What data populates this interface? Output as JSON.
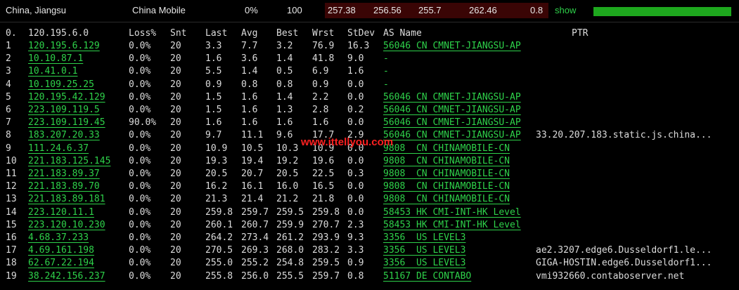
{
  "summary": {
    "location": "China, Jiangsu",
    "isp": "China Mobile",
    "loss": "0%",
    "sent": "100",
    "last": "257.38",
    "avg": "256.56",
    "best": "255.7",
    "worst": "262.46",
    "stdev": "0.8",
    "show_label": "show",
    "progress_percent": 100,
    "progress_color": "#1ea81e"
  },
  "table": {
    "headers": {
      "hop": "0.",
      "host": "120.195.6.0",
      "loss": "Loss%",
      "snt": "Snt",
      "last": "Last",
      "avg": "Avg",
      "best": "Best",
      "wrst": "Wrst",
      "stdev": "StDev",
      "asname": "AS Name",
      "ptr": "PTR"
    },
    "rows": [
      {
        "hop": "1",
        "host": "120.195.6.129",
        "loss": "0.0%",
        "snt": "20",
        "last": "3.3",
        "avg": "7.7",
        "best": "3.2",
        "wrst": "76.9",
        "stdev": "16.3",
        "as": "56046 CN CMNET-JIANGSU-AP",
        "ptr": ""
      },
      {
        "hop": "2",
        "host": "10.10.87.1",
        "loss": "0.0%",
        "snt": "20",
        "last": "1.6",
        "avg": "3.6",
        "best": "1.4",
        "wrst": "41.8",
        "stdev": "9.0",
        "as": "-",
        "ptr": ""
      },
      {
        "hop": "3",
        "host": "10.41.0.1",
        "loss": "0.0%",
        "snt": "20",
        "last": "5.5",
        "avg": "1.4",
        "best": "0.5",
        "wrst": "6.9",
        "stdev": "1.6",
        "as": "-",
        "ptr": ""
      },
      {
        "hop": "4",
        "host": "10.109.25.25",
        "loss": "0.0%",
        "snt": "20",
        "last": "0.9",
        "avg": "0.8",
        "best": "0.8",
        "wrst": "0.9",
        "stdev": "0.0",
        "as": "-",
        "ptr": ""
      },
      {
        "hop": "5",
        "host": "120.195.42.129",
        "loss": "0.0%",
        "snt": "20",
        "last": "1.5",
        "avg": "1.6",
        "best": "1.4",
        "wrst": "2.2",
        "stdev": "0.0",
        "as": "56046 CN CMNET-JIANGSU-AP",
        "ptr": ""
      },
      {
        "hop": "6",
        "host": "223.109.119.5",
        "loss": "0.0%",
        "snt": "20",
        "last": "1.5",
        "avg": "1.6",
        "best": "1.3",
        "wrst": "2.8",
        "stdev": "0.2",
        "as": "56046 CN CMNET-JIANGSU-AP",
        "ptr": ""
      },
      {
        "hop": "7",
        "host": "223.109.119.45",
        "loss": "90.0%",
        "snt": "20",
        "last": "1.6",
        "avg": "1.6",
        "best": "1.6",
        "wrst": "1.6",
        "stdev": "0.0",
        "as": "56046 CN CMNET-JIANGSU-AP",
        "ptr": ""
      },
      {
        "hop": "8",
        "host": "183.207.20.33",
        "loss": "0.0%",
        "snt": "20",
        "last": "9.7",
        "avg": "11.1",
        "best": "9.6",
        "wrst": "17.7",
        "stdev": "2.9",
        "as": "56046 CN CMNET-JIANGSU-AP",
        "ptr": "33.20.207.183.static.js.china..."
      },
      {
        "hop": "9",
        "host": "111.24.6.37",
        "loss": "0.0%",
        "snt": "20",
        "last": "10.9",
        "avg": "10.5",
        "best": "10.3",
        "wrst": "10.9",
        "stdev": "0.0",
        "as": "9808  CN CHINAMOBILE-CN",
        "ptr": ""
      },
      {
        "hop": "10",
        "host": "221.183.125.145",
        "loss": "0.0%",
        "snt": "20",
        "last": "19.3",
        "avg": "19.4",
        "best": "19.2",
        "wrst": "19.6",
        "stdev": "0.0",
        "as": "9808  CN CHINAMOBILE-CN",
        "ptr": ""
      },
      {
        "hop": "11",
        "host": "221.183.89.37",
        "loss": "0.0%",
        "snt": "20",
        "last": "20.5",
        "avg": "20.7",
        "best": "20.5",
        "wrst": "22.5",
        "stdev": "0.3",
        "as": "9808  CN CHINAMOBILE-CN",
        "ptr": ""
      },
      {
        "hop": "12",
        "host": "221.183.89.70",
        "loss": "0.0%",
        "snt": "20",
        "last": "16.2",
        "avg": "16.1",
        "best": "16.0",
        "wrst": "16.5",
        "stdev": "0.0",
        "as": "9808  CN CHINAMOBILE-CN",
        "ptr": ""
      },
      {
        "hop": "13",
        "host": "221.183.89.181",
        "loss": "0.0%",
        "snt": "20",
        "last": "21.3",
        "avg": "21.4",
        "best": "21.2",
        "wrst": "21.8",
        "stdev": "0.0",
        "as": "9808  CN CHINAMOBILE-CN",
        "ptr": ""
      },
      {
        "hop": "14",
        "host": "223.120.11.1",
        "loss": "0.0%",
        "snt": "20",
        "last": "259.8",
        "avg": "259.7",
        "best": "259.5",
        "wrst": "259.8",
        "stdev": "0.0",
        "as": "58453 HK CMI-INT-HK Level",
        "ptr": ""
      },
      {
        "hop": "15",
        "host": "223.120.10.230",
        "loss": "0.0%",
        "snt": "20",
        "last": "260.1",
        "avg": "260.7",
        "best": "259.9",
        "wrst": "270.7",
        "stdev": "2.3",
        "as": "58453 HK CMI-INT-HK Level",
        "ptr": ""
      },
      {
        "hop": "16",
        "host": "4.68.37.233",
        "loss": "0.0%",
        "snt": "20",
        "last": "264.2",
        "avg": "273.4",
        "best": "261.2",
        "wrst": "293.9",
        "stdev": "9.3",
        "as": "3356  US LEVEL3",
        "ptr": ""
      },
      {
        "hop": "17",
        "host": "4.69.161.198",
        "loss": "0.0%",
        "snt": "20",
        "last": "270.5",
        "avg": "269.3",
        "best": "268.0",
        "wrst": "283.2",
        "stdev": "3.3",
        "as": "3356  US LEVEL3",
        "ptr": "ae2.3207.edge6.Dusseldorf1.le..."
      },
      {
        "hop": "18",
        "host": "62.67.22.194",
        "loss": "0.0%",
        "snt": "20",
        "last": "255.0",
        "avg": "255.2",
        "best": "254.8",
        "wrst": "259.5",
        "stdev": "0.9",
        "as": "3356  US LEVEL3",
        "ptr": "GIGA-HOSTIN.edge6.Dusseldorf1..."
      },
      {
        "hop": "19",
        "host": "38.242.156.237",
        "loss": "0.0%",
        "snt": "20",
        "last": "255.8",
        "avg": "256.0",
        "best": "255.5",
        "wrst": "259.7",
        "stdev": "0.8",
        "as": "51167 DE CONTABO",
        "ptr": "vmi932660.contaboserver.net"
      }
    ]
  },
  "watermark": "www.ittellyou.com"
}
